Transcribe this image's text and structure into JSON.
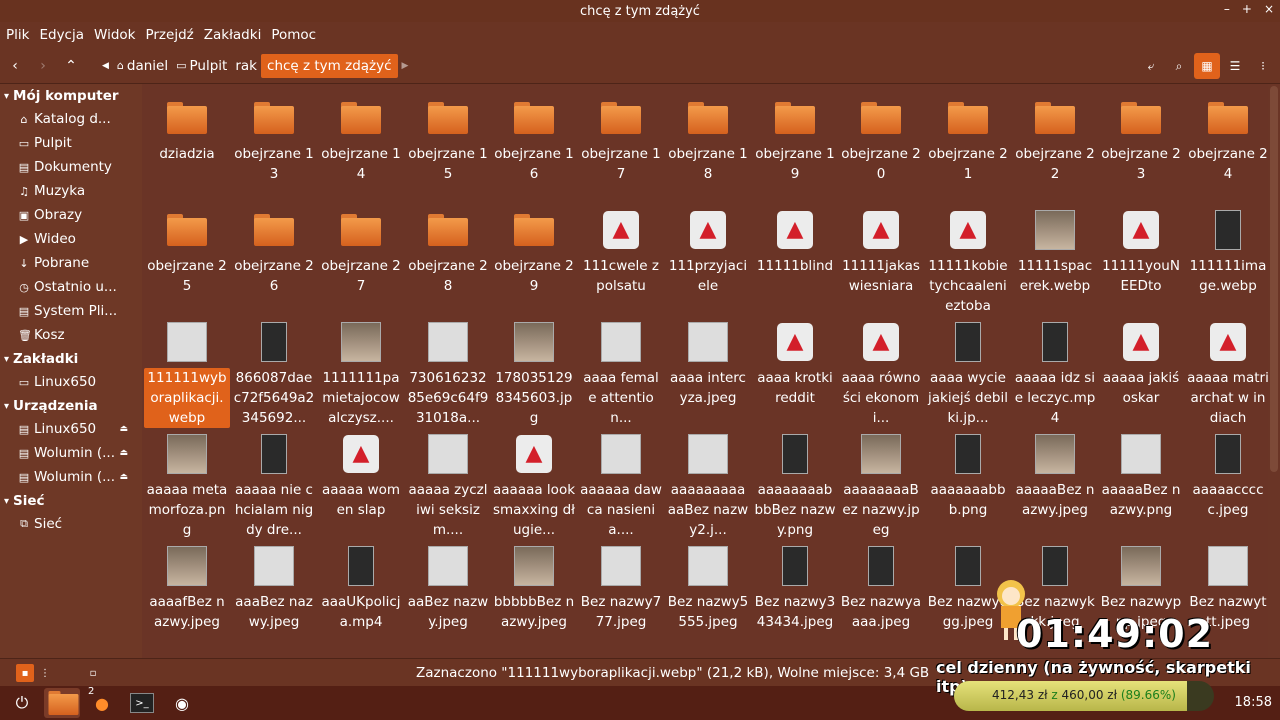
{
  "window": {
    "title": "chcę z tym zdążyć"
  },
  "menu": [
    "Plik",
    "Edycja",
    "Widok",
    "Przejdź",
    "Zakładki",
    "Pomoc"
  ],
  "breadcrumbs": [
    {
      "label": "daniel",
      "icon": "home-icon"
    },
    {
      "label": "Pulpit",
      "icon": "folder-icon"
    },
    {
      "label": "rak",
      "icon": ""
    },
    {
      "label": "chcę z tym zdążyć",
      "icon": "",
      "active": true
    }
  ],
  "sidebar": [
    {
      "header": "Mój komputer",
      "items": [
        {
          "label": "Katalog d...",
          "icon": "home-icon"
        },
        {
          "label": "Pulpit",
          "icon": "folder-icon"
        },
        {
          "label": "Dokumenty",
          "icon": "document-icon"
        },
        {
          "label": "Muzyka",
          "icon": "music-icon"
        },
        {
          "label": "Obrazy",
          "icon": "image-icon"
        },
        {
          "label": "Wideo",
          "icon": "video-icon"
        },
        {
          "label": "Pobrane",
          "icon": "download-icon"
        },
        {
          "label": "Ostatnio u...",
          "icon": "clock-icon"
        },
        {
          "label": "System Pli...",
          "icon": "drive-icon"
        },
        {
          "label": "Kosz",
          "icon": "trash-icon"
        }
      ]
    },
    {
      "header": "Zakładki",
      "items": [
        {
          "label": "Linux650",
          "icon": "folder-icon"
        }
      ]
    },
    {
      "header": "Urządzenia",
      "items": [
        {
          "label": "Linux650",
          "icon": "drive-icon",
          "eject": true
        },
        {
          "label": "Wolumin (...",
          "icon": "drive-icon",
          "eject": true
        },
        {
          "label": "Wolumin (...",
          "icon": "drive-icon",
          "eject": true
        }
      ]
    },
    {
      "header": "Sieć",
      "items": [
        {
          "label": "Sieć",
          "icon": "network-icon"
        }
      ]
    }
  ],
  "files": [
    [
      "folder",
      "dziadzia"
    ],
    [
      "folder",
      "obejrzane 13"
    ],
    [
      "folder",
      "obejrzane 14"
    ],
    [
      "folder",
      "obejrzane 15"
    ],
    [
      "folder",
      "obejrzane 16"
    ],
    [
      "folder",
      "obejrzane 17"
    ],
    [
      "folder",
      "obejrzane 18"
    ],
    [
      "folder",
      "obejrzane 19"
    ],
    [
      "folder",
      "obejrzane 20"
    ],
    [
      "folder",
      "obejrzane 21"
    ],
    [
      "folder",
      "obejrzane 22"
    ],
    [
      "folder",
      "obejrzane 23"
    ],
    [
      "folder",
      "obejrzane 24"
    ],
    [
      "folder",
      "obejrzane 25"
    ],
    [
      "folder",
      "obejrzane 26"
    ],
    [
      "folder",
      "obejrzane 27"
    ],
    [
      "folder",
      "obejrzane 28"
    ],
    [
      "folder",
      "obejrzane 29"
    ],
    [
      "rocket",
      "111cwele z polsatu"
    ],
    [
      "rocket",
      "111przyjaciele"
    ],
    [
      "rocket",
      "11111blind"
    ],
    [
      "rocket",
      "11111jakaswiesniara"
    ],
    [
      "rocket",
      "11111kobietychcaalenieztoba"
    ],
    [
      "photo",
      "11111spacerek.webp"
    ],
    [
      "rocket",
      "11111youNEEDto"
    ],
    [
      "dark",
      "111111image.webp"
    ],
    [
      "img",
      "111111wyboraplikacji.webp"
    ],
    [
      "dark",
      "866087daec72f5649a2345692..."
    ],
    [
      "photo",
      "1111111pamietajocowalczysz...."
    ],
    [
      "img",
      "73061623285e69c64f931018a..."
    ],
    [
      "photo",
      "1780351298345603.jpg"
    ],
    [
      "img",
      "aaaa female attention..."
    ],
    [
      "img",
      "aaaa intercyza.jpeg"
    ],
    [
      "rocket",
      "aaaa krotki reddit"
    ],
    [
      "rocket",
      "aaaa równości ekonomi..."
    ],
    [
      "dark",
      "aaaa wycie jakiejś debilki.jp..."
    ],
    [
      "dark",
      "aaaaa idz sie leczyc.mp4"
    ],
    [
      "rocket",
      "aaaaa jakiś oskar"
    ],
    [
      "rocket",
      "aaaaa matriarchat w indiach"
    ],
    [
      "photo",
      "aaaaa metamorfoza.png"
    ],
    [
      "dark",
      "aaaaa nie chcialam nigdy dre..."
    ],
    [
      "rocket",
      "aaaaa women slap"
    ],
    [
      "img",
      "aaaaa zyczliwi seksizm...."
    ],
    [
      "rocket",
      "aaaaaa looksmaxxing długie..."
    ],
    [
      "img",
      "aaaaaa dawca nasienia...."
    ],
    [
      "img",
      "aaaaaaaaaaaBez nazwy2.j..."
    ],
    [
      "dark",
      "aaaaaaaabbbBez nazwy.png"
    ],
    [
      "photo",
      "aaaaaaaaBez nazwy.jpeg"
    ],
    [
      "dark",
      "aaaaaaabbb.png"
    ],
    [
      "photo",
      "aaaaaBez nazwy.jpeg"
    ],
    [
      "img",
      "aaaaaBez nazwy.png"
    ],
    [
      "dark",
      "aaaaaccccc.jpeg"
    ],
    [
      "photo",
      "aaaafBez nazwy.jpeg"
    ],
    [
      "img",
      "aaaBez nazwy.jpeg"
    ],
    [
      "dark",
      "aaaUKpolicja.mp4"
    ],
    [
      "img",
      "aaBez nazwy.jpeg"
    ],
    [
      "photo",
      "bbbbbBez nazwy.jpeg"
    ],
    [
      "img",
      "Bez nazwy777.jpeg"
    ],
    [
      "img",
      "Bez nazwy5555.jpeg"
    ],
    [
      "dark",
      "Bez nazwy343434.jpeg"
    ],
    [
      "dark",
      "Bez nazwyaaaa.jpeg"
    ],
    [
      "dark",
      "Bez nazwyggg.jpeg"
    ],
    [
      "dark",
      "Bez nazwykkk.jpeg"
    ],
    [
      "photo",
      "Bez nazwyppp.jpeg"
    ],
    [
      "img",
      "Bez nazwyttt.jpeg"
    ]
  ],
  "selected_index": 26,
  "status": {
    "text": "Zaznaczono \"111111wyboraplikacji.webp\" (21,2 kB), Wolne miejsce: 3,4 GB"
  },
  "taskbar": {
    "clock": "18:58",
    "badge": "2"
  },
  "overlay": {
    "timer": "01:49:02",
    "goal": "cel dzienny (na żywność, skarpetki itp)",
    "current": "412,43 zł",
    "sep": "z",
    "target": "460,00 zł",
    "percent_text": "(89.66%)",
    "progress": 0.8966
  },
  "colors": {
    "accent": "#e0621b",
    "folder": "#f39a4a",
    "background": "#6a3426"
  }
}
